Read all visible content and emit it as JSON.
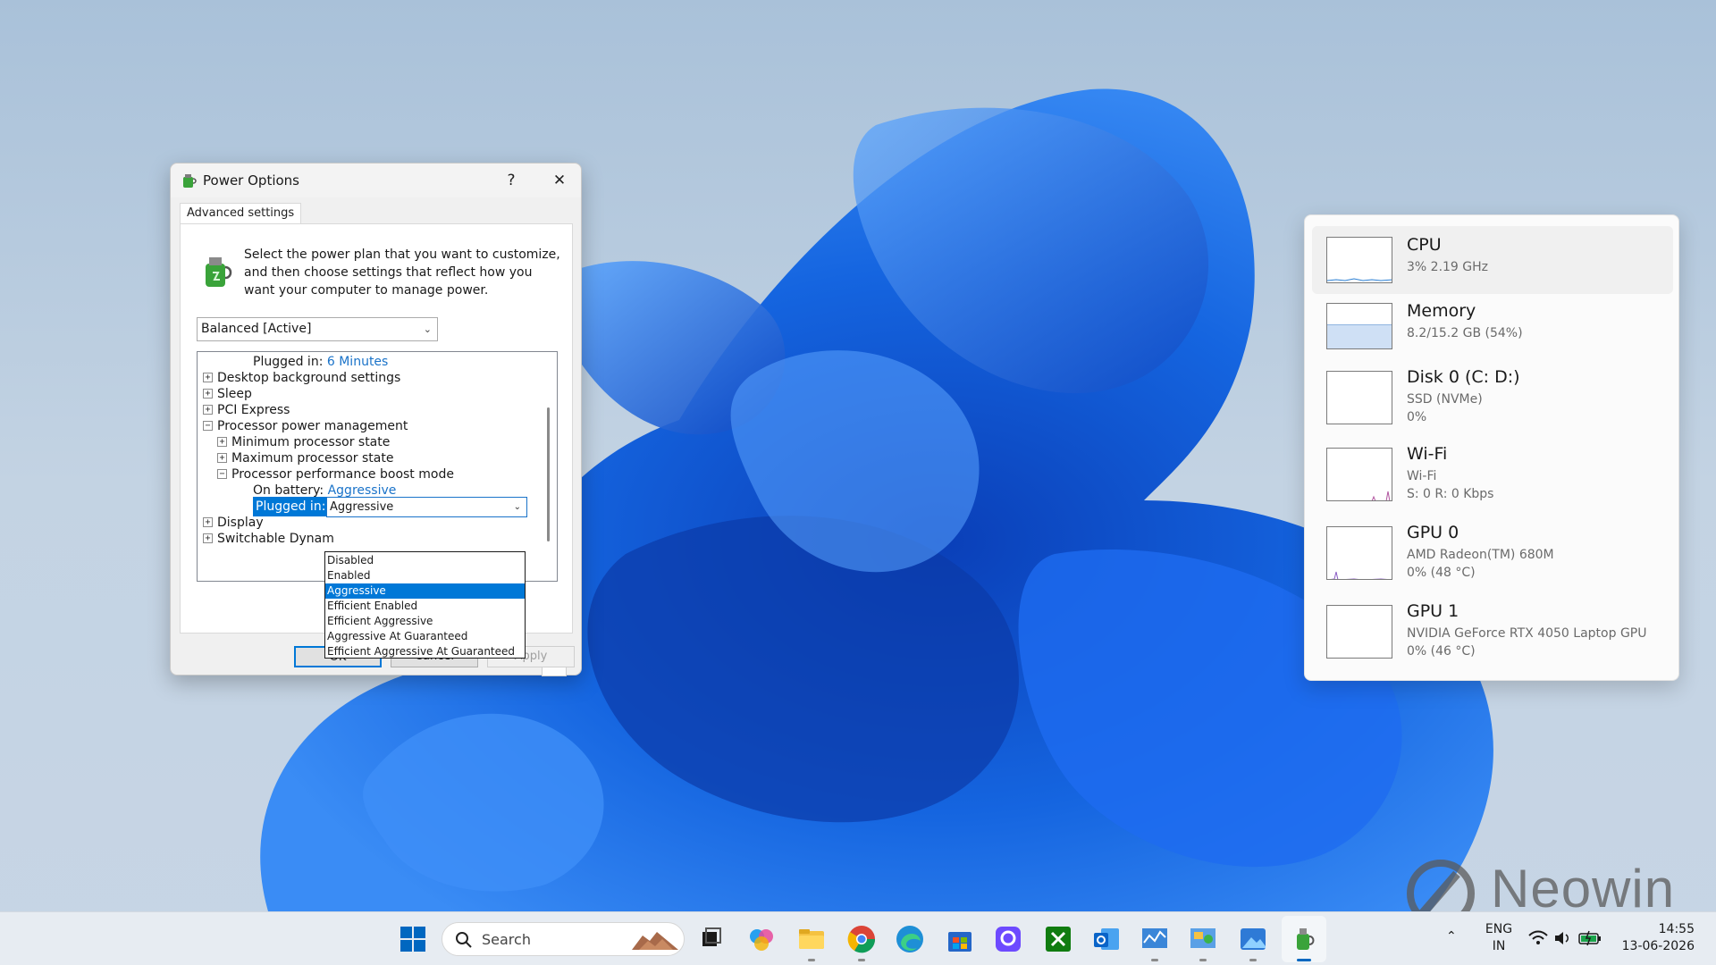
{
  "dialog": {
    "title": "Power Options",
    "help_label": "?",
    "close_label": "✕",
    "tab": "Advanced settings",
    "description": "Select the power plan that you want to customize, and then choose settings that reflect how you want your computer to manage power.",
    "plan_select": "Balanced [Active]",
    "tree": {
      "plugged_in_label": "Plugged in:",
      "plugged_in_value": "6 Minutes",
      "desktop_background": "Desktop background settings",
      "sleep": "Sleep",
      "pci_express": "PCI Express",
      "processor_power_management": "Processor power management",
      "min_processor_state": "Minimum processor state",
      "max_processor_state": "Maximum processor state",
      "boost_mode": "Processor performance boost mode",
      "on_battery_label": "On battery:",
      "on_battery_value": "Aggressive",
      "boost_plugged_in_label": "Plugged in:",
      "boost_plugged_in_value": "Aggressive",
      "display": "Display",
      "switchable": "Switchable Dynam"
    },
    "dropdown_options": [
      "Disabled",
      "Enabled",
      "Aggressive",
      "Efficient Enabled",
      "Efficient Aggressive",
      "Aggressive At Guaranteed",
      "Efficient Aggressive At Guaranteed"
    ],
    "selected_option": "Aggressive",
    "buttons": {
      "ok": "OK",
      "cancel": "Cancel",
      "apply": "Apply"
    }
  },
  "performance": {
    "items": [
      {
        "name": "CPU",
        "line1": "3%  2.19 GHz",
        "line2": ""
      },
      {
        "name": "Memory",
        "line1": "8.2/15.2 GB (54%)",
        "line2": ""
      },
      {
        "name": "Disk 0 (C: D:)",
        "line1": "SSD (NVMe)",
        "line2": "0%"
      },
      {
        "name": "Wi-Fi",
        "line1": "Wi-Fi",
        "line2": "S: 0  R: 0 Kbps"
      },
      {
        "name": "GPU 0",
        "line1": "AMD Radeon(TM) 680M",
        "line2": "0%  (48 °C)"
      },
      {
        "name": "GPU 1",
        "line1": "NVIDIA GeForce RTX 4050 Laptop GPU",
        "line2": "0%  (46 °C)"
      }
    ],
    "memory_usage_fraction": 0.54
  },
  "taskbar": {
    "search_label": "Search",
    "language": "ENG",
    "region": "IN",
    "time": "14:55",
    "date": "13-06-2026"
  },
  "watermark": "Neowin",
  "colors": {
    "accent": "#0078d7",
    "link": "#1a73c9",
    "wallpaper_blue": "#1565e0"
  }
}
